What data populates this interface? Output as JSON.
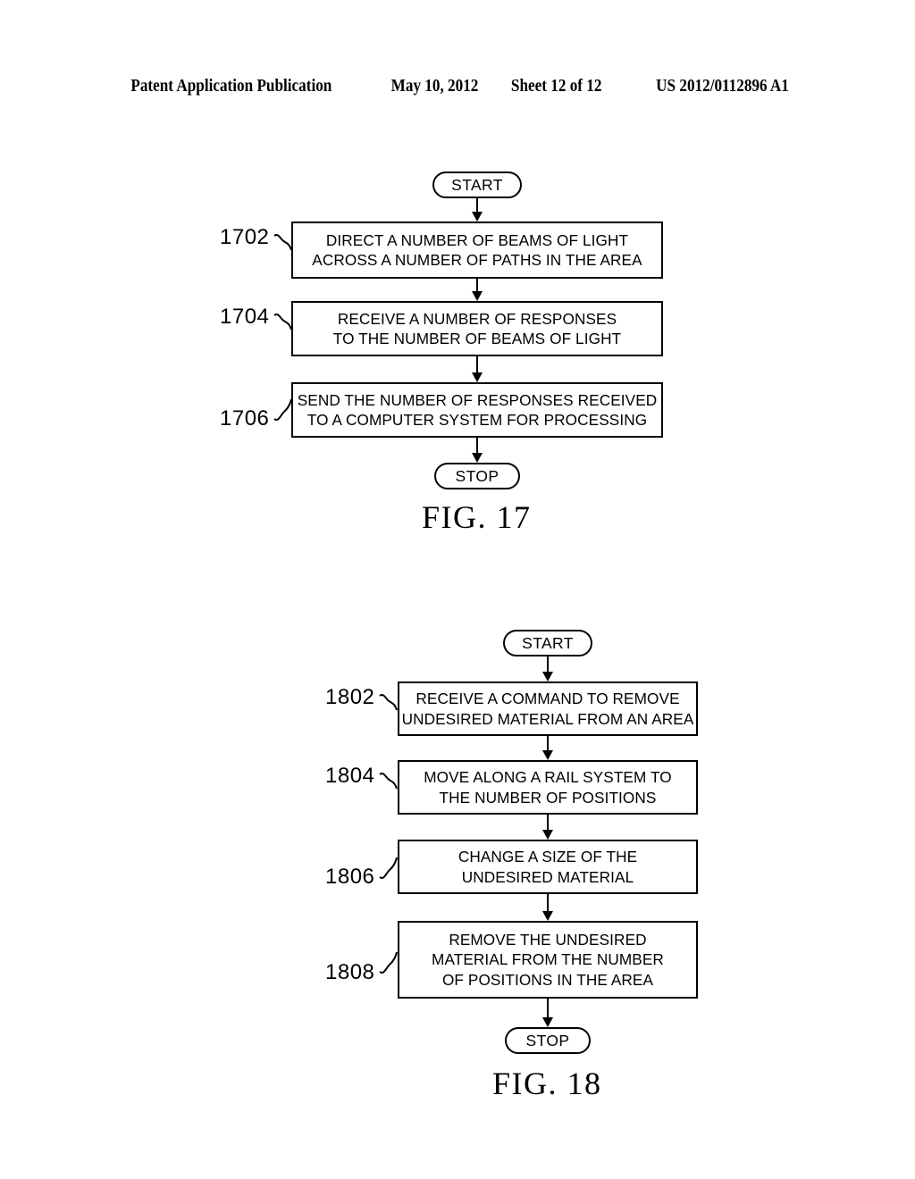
{
  "header": {
    "publication": "Patent Application Publication",
    "date": "May 10, 2012",
    "sheet": "Sheet 12 of 12",
    "patent_number": "US 2012/0112896 A1"
  },
  "figures": [
    {
      "id": "fig-17",
      "caption": "FIG. 17",
      "start_label": "START",
      "stop_label": "STOP",
      "steps": [
        {
          "ref": "1702",
          "lines": [
            "DIRECT A NUMBER OF BEAMS OF LIGHT",
            "ACROSS A NUMBER OF PATHS IN THE AREA"
          ]
        },
        {
          "ref": "1704",
          "lines": [
            "RECEIVE A NUMBER OF RESPONSES",
            "TO THE NUMBER OF BEAMS OF LIGHT"
          ]
        },
        {
          "ref": "1706",
          "lines": [
            "SEND THE NUMBER OF RESPONSES RECEIVED",
            "TO A COMPUTER SYSTEM FOR PROCESSING"
          ]
        }
      ]
    },
    {
      "id": "fig-18",
      "caption": "FIG. 18",
      "start_label": "START",
      "stop_label": "STOP",
      "steps": [
        {
          "ref": "1802",
          "lines": [
            "RECEIVE A COMMAND TO REMOVE",
            "UNDESIRED MATERIAL FROM AN AREA"
          ]
        },
        {
          "ref": "1804",
          "lines": [
            "MOVE ALONG A RAIL SYSTEM TO",
            "THE NUMBER OF POSITIONS"
          ]
        },
        {
          "ref": "1806",
          "lines": [
            "CHANGE A SIZE OF THE",
            "UNDESIRED MATERIAL"
          ]
        },
        {
          "ref": "1808",
          "lines": [
            "REMOVE THE UNDESIRED",
            "MATERIAL FROM THE NUMBER",
            "OF POSITIONS IN THE AREA"
          ]
        }
      ]
    }
  ],
  "colors": {
    "ink": "#000000",
    "paper": "#ffffff"
  }
}
